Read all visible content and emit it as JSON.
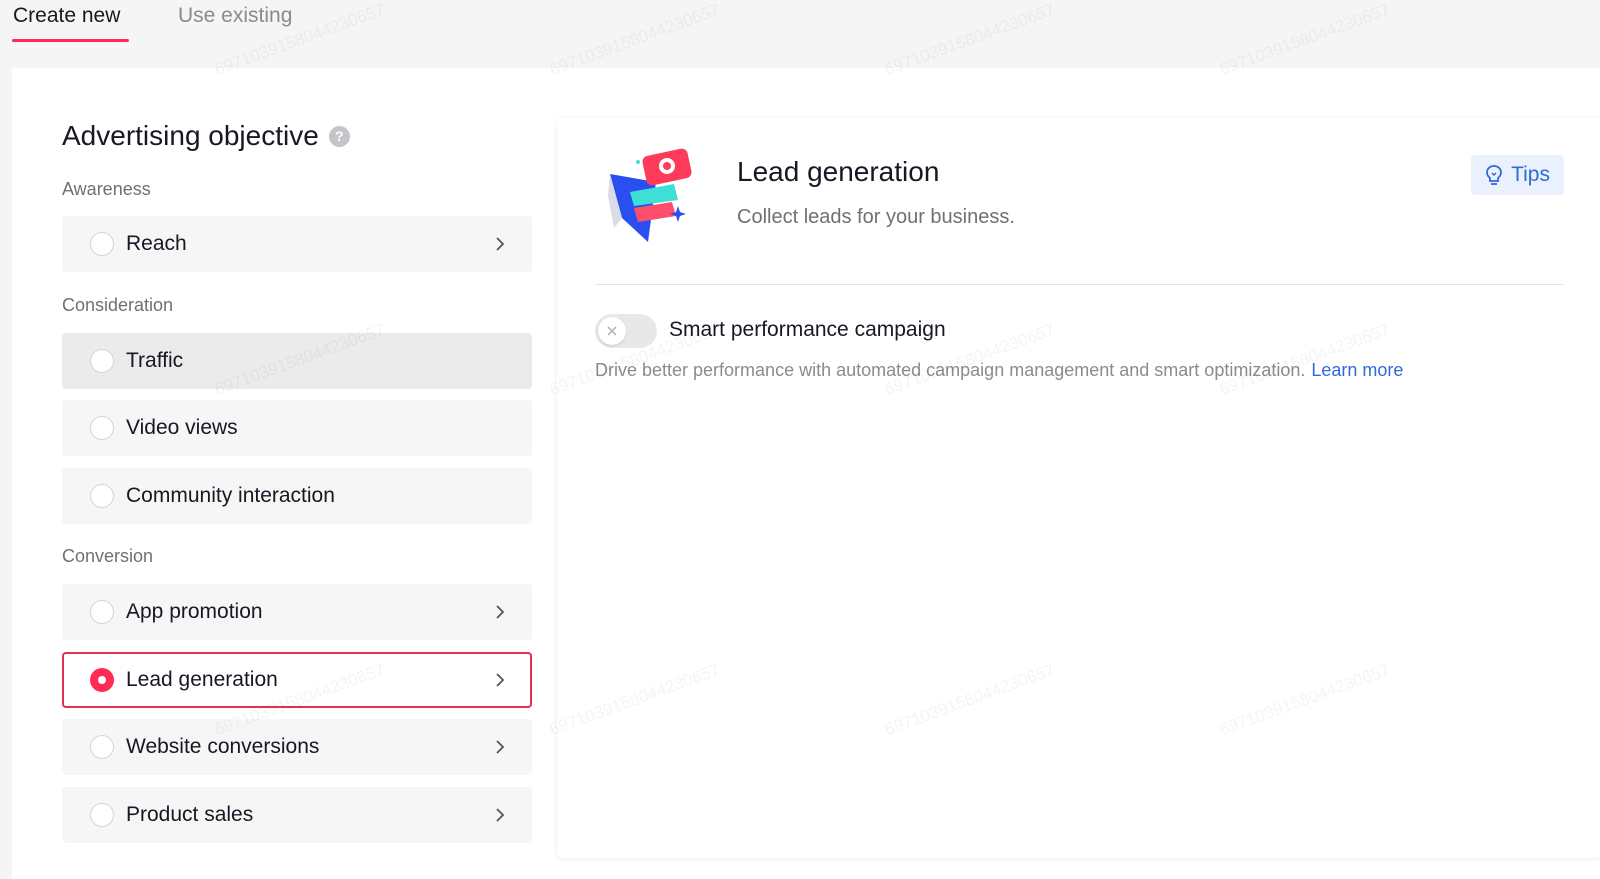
{
  "tabs": {
    "create_new": "Create new",
    "use_existing": "Use existing"
  },
  "objective": {
    "title": "Advertising objective",
    "help_icon": "question-circle-icon",
    "groups": {
      "awareness": "Awareness",
      "consideration": "Consideration",
      "conversion": "Conversion"
    },
    "options": [
      {
        "label": "Reach",
        "has_chevron": true,
        "state": "default"
      },
      {
        "label": "Traffic",
        "has_chevron": false,
        "state": "hovered"
      },
      {
        "label": "Video views",
        "has_chevron": false,
        "state": "default"
      },
      {
        "label": "Community interaction",
        "has_chevron": false,
        "state": "default"
      },
      {
        "label": "App promotion",
        "has_chevron": true,
        "state": "default"
      },
      {
        "label": "Lead generation",
        "has_chevron": true,
        "state": "selected"
      },
      {
        "label": "Website conversions",
        "has_chevron": true,
        "state": "default"
      },
      {
        "label": "Product sales",
        "has_chevron": true,
        "state": "default"
      }
    ]
  },
  "detail": {
    "title": "Lead generation",
    "description": "Collect leads for your business.",
    "tips_label": "Tips",
    "tips_icon": "lightbulb-icon",
    "smart_campaign": {
      "label": "Smart performance campaign",
      "enabled": false,
      "description": "Drive better performance with automated campaign management and smart optimization.",
      "learn_more": "Learn more"
    }
  },
  "watermark_text": "6971039158044230657",
  "colors": {
    "accent": "#fe2c55",
    "link": "#2e6bd9",
    "tips_bg": "#eaf1fd"
  }
}
